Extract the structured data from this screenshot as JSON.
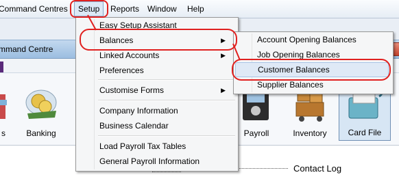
{
  "menubar": {
    "items": [
      {
        "label": "Command Centres"
      },
      {
        "label": "Setup"
      },
      {
        "label": "Reports"
      },
      {
        "label": "Window"
      },
      {
        "label": "Help"
      }
    ]
  },
  "window": {
    "title": "mmand Centre"
  },
  "command_centre": {
    "items": [
      {
        "label": "s"
      },
      {
        "label": "Banking"
      },
      {
        "label": "Payroll"
      },
      {
        "label": "Inventory"
      },
      {
        "label": "Card File"
      }
    ],
    "contact_log": "Contact Log"
  },
  "setup_menu": {
    "items": [
      {
        "label": "Easy Setup Assistant"
      },
      {
        "label": "Balances",
        "submenu": true
      },
      {
        "label": "Linked Accounts",
        "submenu": true
      },
      {
        "label": "Preferences"
      },
      {
        "label": "Customise Forms",
        "submenu": true
      },
      {
        "label": "Company Information"
      },
      {
        "label": "Business Calendar"
      },
      {
        "label": "Load Payroll Tax Tables"
      },
      {
        "label": "General Payroll Information"
      }
    ]
  },
  "balances_menu": {
    "items": [
      {
        "label": "Account Opening Balances"
      },
      {
        "label": "Job Opening Balances"
      },
      {
        "label": "Customer Balances"
      },
      {
        "label": "Supplier Balances"
      }
    ]
  },
  "colors": {
    "annotation": "#e0201f",
    "highlight": "#dfe9f6"
  }
}
